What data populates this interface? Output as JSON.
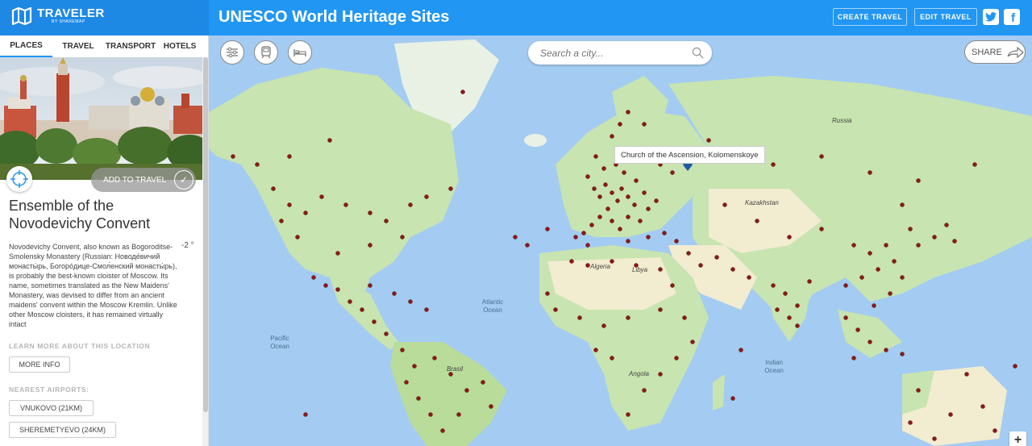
{
  "app": {
    "name": "TRAVELER",
    "subtitle": "BY SHAREMAP"
  },
  "header": {
    "title": "UNESCO World Heritage Sites",
    "create_label": "CREATE TRAVEL",
    "edit_label": "EDIT TRAVEL",
    "twitter_icon": "twitter-icon",
    "facebook_icon": "facebook-icon"
  },
  "sidebar": {
    "tabs": [
      {
        "label": "PLACES",
        "active": true
      },
      {
        "label": "TRAVEL",
        "active": false
      },
      {
        "label": "TRANSPORT",
        "active": false
      },
      {
        "label": "HOTELS",
        "active": false
      }
    ],
    "add_to_travel": "ADD TO TRAVEL",
    "place_title": "Ensemble of the Novodevichy Convent",
    "temperature": "-2 °",
    "description": "Novodevichy Convent, also known as Bogoroditse-Smolensky Monastery (Russian: Новоде́вичий монасты́рь, Богоро́дице-Смол́енский монасты́рь), is probably the best-known cloister of Moscow. Its name, sometimes translated as the New Maidens' Monastery, was devised to differ from an ancient maidens' convent within the Moscow Kremlin. Unlike other Moscow cloisters, it has remained virtually intact",
    "learn_more_label": "LEARN MORE ABOUT THIS LOCATION",
    "more_info": "MORE INFO",
    "nearest_airports_label": "NEAREST AIRPORTS:",
    "airports": [
      "VNUKOVO (21KM)",
      "SHEREMETYEVO (24KM)"
    ]
  },
  "map": {
    "search_placeholder": "Search a city...",
    "share_label": "SHARE",
    "tooltip": "Church of the Ascension, Kolomenskoye",
    "zoom_in": "+",
    "labels": {
      "russia": "Russia",
      "kazakhstan": "Kazakhstan",
      "algeria": "Algeria",
      "libya": "Libya",
      "atlantic": "Atlantic Ocean",
      "pacific": "Pacific Ocean",
      "indian": "Indian Ocean",
      "brasil": "Brasil",
      "angola": "Angola"
    },
    "colors": {
      "water": "#a4ccf2",
      "land": "#c8e4b0",
      "desert": "#f2ecd0",
      "marker": "#8b1a1a"
    }
  }
}
